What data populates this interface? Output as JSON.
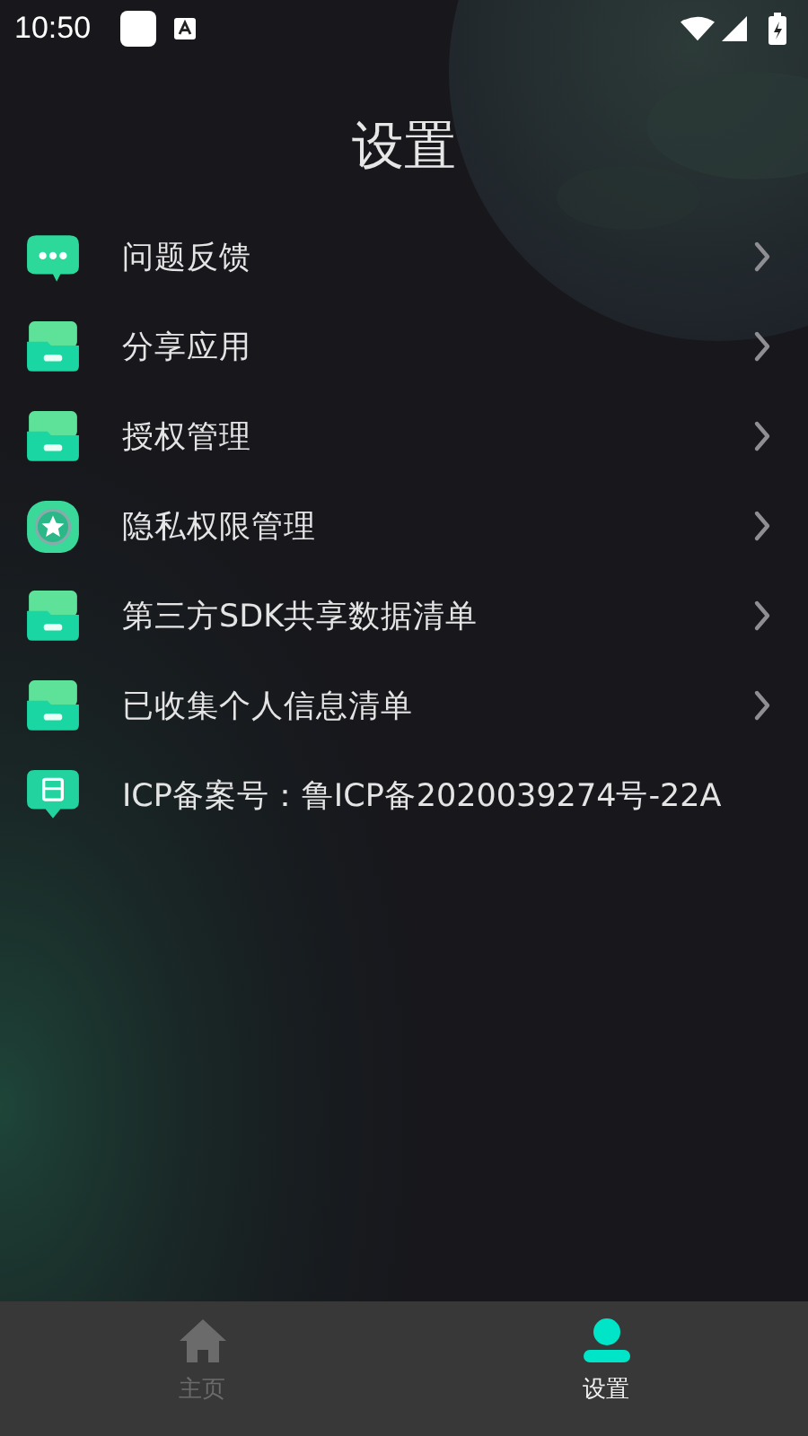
{
  "status_bar": {
    "time": "10:50"
  },
  "title": "设置",
  "items": [
    {
      "kind": "chat",
      "label": "问题反馈",
      "chevron": true
    },
    {
      "kind": "folder",
      "label": "分享应用",
      "chevron": true
    },
    {
      "kind": "folder",
      "label": "授权管理",
      "chevron": true
    },
    {
      "kind": "badge",
      "label": "隐私权限管理",
      "chevron": true
    },
    {
      "kind": "folder",
      "label": "第三方SDK共享数据清单",
      "chevron": true
    },
    {
      "kind": "folder",
      "label": "已收集个人信息清单",
      "chevron": true
    },
    {
      "kind": "record",
      "label": "ICP备案号：鲁ICP备2020039274号-22A",
      "chevron": false
    }
  ],
  "tabs": [
    {
      "kind": "home",
      "label": "主页",
      "selected": false
    },
    {
      "kind": "person",
      "label": "设置",
      "selected": true
    }
  ]
}
